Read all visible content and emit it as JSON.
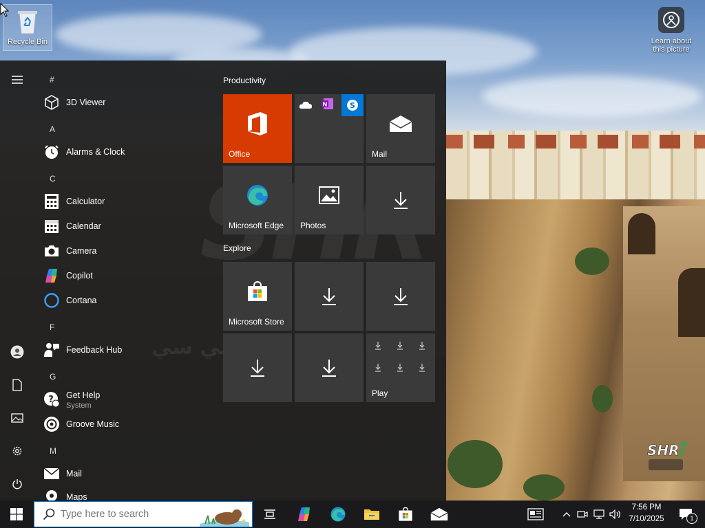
{
  "desktop": {
    "recycle_bin_label": "Recycle Bin",
    "learn_label_line1": "Learn about",
    "learn_label_line2": "this picture"
  },
  "start_menu": {
    "letters": {
      "hash": "#",
      "a": "A",
      "c": "C",
      "f": "F",
      "g": "G",
      "m": "M"
    },
    "apps": {
      "viewer3d": "3D Viewer",
      "alarms": "Alarms & Clock",
      "calculator": "Calculator",
      "calendar": "Calendar",
      "camera": "Camera",
      "copilot": "Copilot",
      "cortana": "Cortana",
      "feedback": "Feedback Hub",
      "gethelp": "Get Help",
      "gethelp_sub": "System",
      "groove": "Groove Music",
      "mail": "Mail",
      "maps": "Maps"
    },
    "groups": {
      "productivity": "Productivity",
      "explore": "Explore"
    },
    "tiles": {
      "office": "Office",
      "mail": "Mail",
      "edge": "Microsoft Edge",
      "photos": "Photos",
      "store": "Microsoft Store",
      "play": "Play"
    }
  },
  "taskbar": {
    "search_placeholder": "Type here to search",
    "time": "7:56 PM",
    "date": "7/10/2025",
    "notification_count": "1"
  },
  "watermark": {
    "main": "SHR",
    "arabic": "بي سي"
  },
  "colors": {
    "office": "#d83b01",
    "accent": "#0078d4",
    "skype": "#0078d7",
    "onenote": "#7719aa"
  }
}
